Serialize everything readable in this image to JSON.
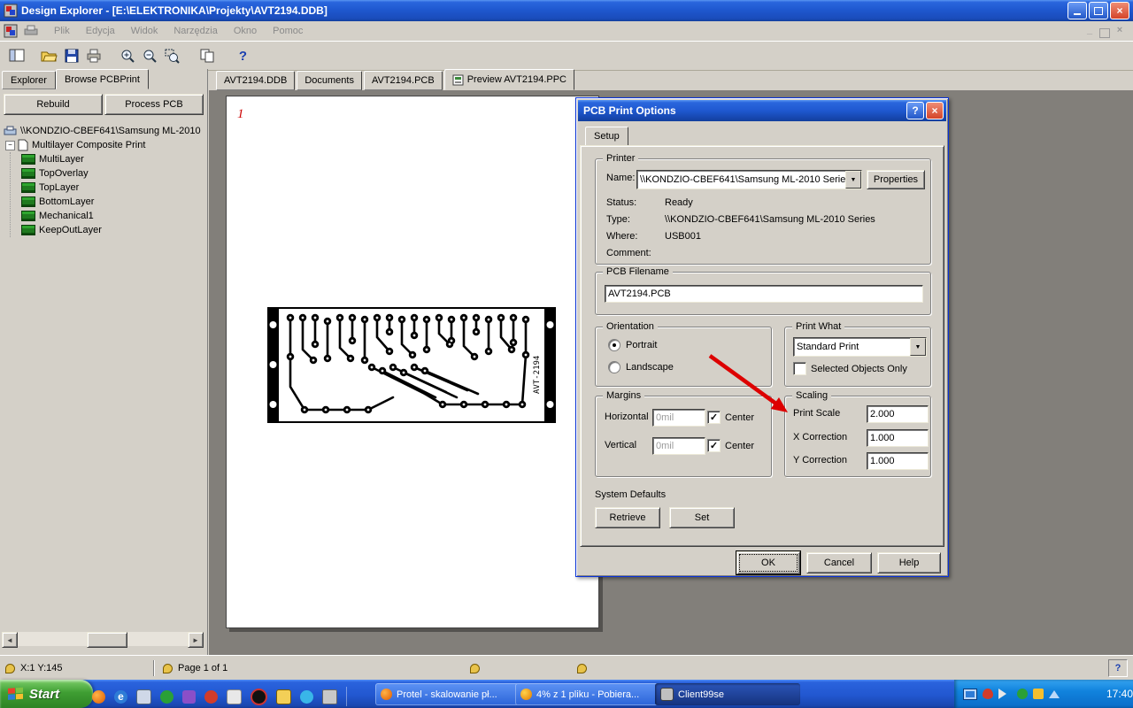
{
  "window": {
    "title": "Design Explorer - [E:\\ELEKTRONIKA\\Projekty\\AVT2194.DDB]"
  },
  "menu": {
    "items": [
      "Plik",
      "Edycja",
      "Widok",
      "Narzędzia",
      "Okno",
      "Pomoc"
    ]
  },
  "toolbar": {
    "help": "?"
  },
  "explorer": {
    "tabs": [
      "Explorer",
      "Browse PCBPrint"
    ],
    "rebuild": "Rebuild",
    "process": "Process PCB",
    "root": "\\\\KONDZIO-CBEF641\\Samsung ML-2010",
    "composite": "Multilayer Composite Print",
    "layers": [
      "MultiLayer",
      "TopOverlay",
      "TopLayer",
      "BottomLayer",
      "Mechanical1",
      "KeepOutLayer"
    ]
  },
  "doc_tabs": [
    "AVT2194.DDB",
    "Documents",
    "AVT2194.PCB",
    "Preview AVT2194.PPC"
  ],
  "preview": {
    "page_marker": "1",
    "board_label": "AVT-2194"
  },
  "dialog": {
    "title": "PCB Print Options",
    "tab": "Setup",
    "printer": {
      "label": "Printer",
      "name_label": "Name:",
      "name_value": "\\\\KONDZIO-CBEF641\\Samsung ML-2010 Series",
      "properties": "Properties",
      "status_label": "Status:",
      "status_value": "Ready",
      "type_label": "Type:",
      "type_value": "\\\\KONDZIO-CBEF641\\Samsung ML-2010 Series",
      "where_label": "Where:",
      "where_value": "USB001",
      "comment_label": "Comment:"
    },
    "filename": {
      "label": "PCB Filename",
      "value": "AVT2194.PCB"
    },
    "orientation": {
      "label": "Orientation",
      "portrait": "Portrait",
      "landscape": "Landscape"
    },
    "print_what": {
      "label": "Print What",
      "value": "Standard Print",
      "selected_only": "Selected Objects Only"
    },
    "margins": {
      "label": "Margins",
      "horizontal": "Horizontal",
      "vertical": "Vertical",
      "h_value": "0mil",
      "v_value": "0mil",
      "center": "Center"
    },
    "scaling": {
      "label": "Scaling",
      "print_scale": "Print Scale",
      "print_scale_value": "2.000",
      "x_correction": "X Correction",
      "x_value": "1.000",
      "y_correction": "Y Correction",
      "y_value": "1.000"
    },
    "defaults": {
      "label": "System Defaults",
      "retrieve": "Retrieve",
      "set": "Set"
    },
    "ok": "OK",
    "cancel": "Cancel",
    "help": "Help"
  },
  "status": {
    "coords": "X:1 Y:145",
    "page": "Page 1 of 1"
  },
  "taskbar": {
    "start": "Start",
    "tasks": [
      "Protel - skalowanie pł...",
      "4% z 1 pliku - Pobiera...",
      "Client99se"
    ],
    "time": "17:40"
  }
}
